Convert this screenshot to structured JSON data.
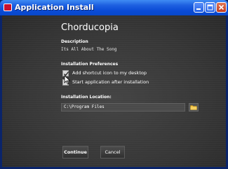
{
  "window": {
    "title": "Application Install",
    "app_icon": "app-icon",
    "controls": [
      "minimize-icon",
      "maximize-icon",
      "close-icon"
    ]
  },
  "app": {
    "name": "Chorducopia"
  },
  "description": {
    "label": "Description",
    "value": "Its All About The Song"
  },
  "preferences": {
    "label": "Installation Preferences",
    "options": [
      {
        "label": "Add shortcut icon to my desktop",
        "checked": true
      },
      {
        "label": "Start application after installation",
        "checked": false
      }
    ]
  },
  "location": {
    "label": "Installation Location:",
    "value": "C:\\Program Files",
    "browse_icon": "folder-icon"
  },
  "actions": {
    "continue_label": "Continue",
    "cancel_label": "Cancel"
  }
}
